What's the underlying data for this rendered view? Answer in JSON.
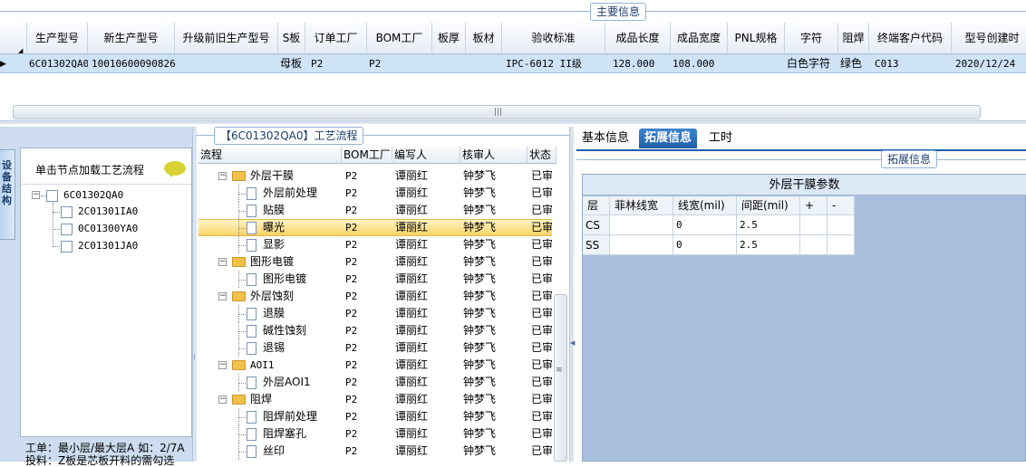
{
  "top": {
    "group_title": "主要信息",
    "columns": [
      "生产型号",
      "新生产型号",
      "升级前旧生产型号",
      "S板",
      "订单工厂",
      "BOM工厂",
      "板厚",
      "板材",
      "验收标准",
      "成品长度",
      "成品宽度",
      "PNL规格",
      "字符",
      "阻焊",
      "终端客户代码",
      "型号创建时"
    ],
    "row": [
      "6C01302QA0",
      "10010600090826",
      "",
      "母板",
      "P2",
      "P2",
      "",
      "",
      "IPC-6012 II级",
      "128.000",
      "108.000",
      "",
      "白色字符",
      "绿色",
      "C013",
      "2020/12/24"
    ],
    "scroll_glyph": "|||"
  },
  "left": {
    "vertical_tab": "设备结构",
    "tree_header": "单击节点加载工艺流程",
    "root": "6C01302QA0",
    "children": [
      "2C01301IA0",
      "0C01300YA0",
      "2C01301JA0"
    ],
    "note_line1": "工单：最小层/最大层A 如：2/7A",
    "note_line2": "投料：Z板是芯板开料的需勾选"
  },
  "middle": {
    "group_title": "【6C01302QA0】工艺流程",
    "headers": [
      "流程",
      "BOM工厂",
      "编写人",
      "核审人",
      "状态"
    ],
    "rows": [
      {
        "level": 1,
        "name": "外层干膜",
        "bom": "P2",
        "writer": "谭丽红",
        "reviewer": "钟梦飞",
        "status": "已审"
      },
      {
        "level": 2,
        "name": "外层前处理",
        "bom": "P2",
        "writer": "谭丽红",
        "reviewer": "钟梦飞",
        "status": "已审"
      },
      {
        "level": 2,
        "name": "贴膜",
        "bom": "P2",
        "writer": "谭丽红",
        "reviewer": "钟梦飞",
        "status": "已审"
      },
      {
        "level": 2,
        "name": "曝光",
        "bom": "P2",
        "writer": "谭丽红",
        "reviewer": "钟梦飞",
        "status": "已审",
        "selected": true
      },
      {
        "level": 2,
        "name": "显影",
        "bom": "P2",
        "writer": "谭丽红",
        "reviewer": "钟梦飞",
        "status": "已审"
      },
      {
        "level": 1,
        "name": "图形电镀",
        "bom": "P2",
        "writer": "谭丽红",
        "reviewer": "钟梦飞",
        "status": "已审"
      },
      {
        "level": 2,
        "name": "图形电镀",
        "bom": "P2",
        "writer": "谭丽红",
        "reviewer": "钟梦飞",
        "status": "已审"
      },
      {
        "level": 1,
        "name": "外层蚀刻",
        "bom": "P2",
        "writer": "谭丽红",
        "reviewer": "钟梦飞",
        "status": "已审"
      },
      {
        "level": 2,
        "name": "退膜",
        "bom": "P2",
        "writer": "谭丽红",
        "reviewer": "钟梦飞",
        "status": "已审"
      },
      {
        "level": 2,
        "name": "碱性蚀刻",
        "bom": "P2",
        "writer": "谭丽红",
        "reviewer": "钟梦飞",
        "status": "已审"
      },
      {
        "level": 2,
        "name": "退锡",
        "bom": "P2",
        "writer": "谭丽红",
        "reviewer": "钟梦飞",
        "status": "已审"
      },
      {
        "level": 1,
        "name": "AOI1",
        "bom": "P2",
        "writer": "谭丽红",
        "reviewer": "钟梦飞",
        "status": "已审"
      },
      {
        "level": 2,
        "name": "外层AOI1",
        "bom": "P2",
        "writer": "谭丽红",
        "reviewer": "钟梦飞",
        "status": "已审"
      },
      {
        "level": 1,
        "name": "阻焊",
        "bom": "P2",
        "writer": "谭丽红",
        "reviewer": "钟梦飞",
        "status": "已审"
      },
      {
        "level": 2,
        "name": "阻焊前处理",
        "bom": "P2",
        "writer": "谭丽红",
        "reviewer": "钟梦飞",
        "status": "已审"
      },
      {
        "level": 2,
        "name": "阻焊塞孔",
        "bom": "P2",
        "writer": "谭丽红",
        "reviewer": "钟梦飞",
        "status": "已审"
      },
      {
        "level": 2,
        "name": "丝印",
        "bom": "P2",
        "writer": "谭丽红",
        "reviewer": "钟梦飞",
        "status": "已审"
      }
    ]
  },
  "right": {
    "tabs": [
      "基本信息",
      "拓展信息",
      "工时"
    ],
    "active_tab": 1,
    "group_title": "拓展信息",
    "param_title": "外层干膜参数",
    "param_headers": [
      "层",
      "菲林线宽",
      "线宽(mil)",
      "间距(mil)",
      "+",
      "-"
    ],
    "param_rows": [
      [
        "CS",
        "",
        "0",
        "2.5",
        "",
        ""
      ],
      [
        "SS",
        "",
        "0",
        "2.5",
        "",
        ""
      ]
    ]
  },
  "colors": {
    "selection_row": "#cfe3f7",
    "highlight_row": "#f9d468",
    "tab_active": "#1f5ea8",
    "panel_bg": "#cddcee",
    "folder": "#f2c14a"
  }
}
